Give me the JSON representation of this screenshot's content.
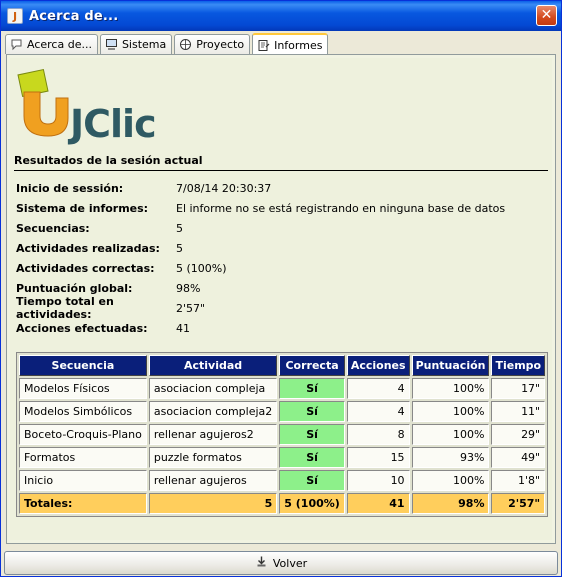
{
  "window": {
    "title": "Acerca de...",
    "title_icon": "jclic-app-icon",
    "close_label": "✕"
  },
  "tabs": [
    {
      "label": "Acerca de...",
      "icon": "speech-bubble-icon",
      "active": false
    },
    {
      "label": "Sistema",
      "icon": "computer-icon",
      "active": false
    },
    {
      "label": "Proyecto",
      "icon": "globe-icon",
      "active": false
    },
    {
      "label": "Informes",
      "icon": "report-icon",
      "active": true
    }
  ],
  "logo": {
    "text": "JClic"
  },
  "session": {
    "title": "Resultados de la sesión actual",
    "rows": [
      {
        "label": "Inicio de sessión:",
        "value": "7/08/14 20:30:37"
      },
      {
        "label": "Sistema de informes:",
        "value": "El informe no se está registrando en ninguna base de datos"
      },
      {
        "label": "Secuencias:",
        "value": "5"
      },
      {
        "label": "Actividades realizadas:",
        "value": "5"
      },
      {
        "label": "Actividades correctas:",
        "value": "5 (100%)"
      },
      {
        "label": "Puntuación global:",
        "value": "98%"
      },
      {
        "label": "Tiempo total en actividades:",
        "value": "2'57\""
      },
      {
        "label": "Acciones efectuadas:",
        "value": "41"
      }
    ]
  },
  "table": {
    "headers": [
      "Secuencia",
      "Actividad",
      "Correcta",
      "Acciones",
      "Puntuación",
      "Tiempo"
    ],
    "rows": [
      [
        "Modelos Físicos",
        "asociacion compleja",
        "Sí",
        "4",
        "100%",
        "17\""
      ],
      [
        "Modelos Simbólicos",
        "asociacion compleja2",
        "Sí",
        "4",
        "100%",
        "11\""
      ],
      [
        "Boceto-Croquis-Plano",
        "rellenar agujeros2",
        "Sí",
        "8",
        "100%",
        "29\""
      ],
      [
        "Formatos",
        "puzzle formatos",
        "Sí",
        "15",
        "93%",
        "49\""
      ],
      [
        "Inicio",
        "rellenar agujeros",
        "Sí",
        "10",
        "100%",
        "1'8\""
      ]
    ],
    "totals": [
      "Totales:",
      "5",
      "5 (100%)",
      "41",
      "98%",
      "2'57\""
    ]
  },
  "footer": {
    "button_label": "Volver",
    "button_icon": "back-icon"
  },
  "colors": {
    "titlebar": "#0449d4",
    "table_header": "#0a1f7a",
    "correct_cell": "#8df08a",
    "totals_row": "#ffce5c",
    "panel_bg": "#eef1dd"
  }
}
